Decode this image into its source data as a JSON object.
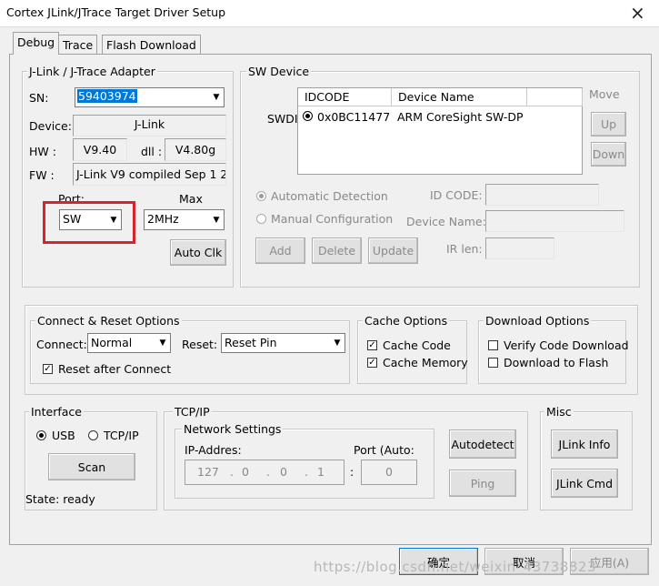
{
  "window": {
    "title": "Cortex JLink/JTrace Target Driver Setup",
    "close_glyph": "×"
  },
  "tabs": [
    {
      "label": "Debug"
    },
    {
      "label": "Trace"
    },
    {
      "label": "Flash Download"
    }
  ],
  "adapter": {
    "group_title": "J-Link / J-Trace Adapter",
    "sn_label": "SN:",
    "sn_value": "59403974",
    "device_label": "Device:",
    "device_value": "J-Link",
    "hw_label": "HW :",
    "hw_value": "V9.40",
    "dll_label": "dll :",
    "dll_value": "V4.80g",
    "fw_label": "FW :",
    "fw_value": "J-Link V9 compiled Sep  1 2",
    "port_label": "Port:",
    "port_value": "SW",
    "max_label": "Max",
    "max_value": "2MHz",
    "auto_clk": "Auto Clk"
  },
  "sw_device": {
    "group_title": "SW Device",
    "swdi_label": "SWDI",
    "columns": [
      "IDCODE",
      "Device Name"
    ],
    "rows": [
      {
        "idcode": "0x0BC11477",
        "name": "ARM CoreSight SW-DP"
      }
    ],
    "move_label": "Move",
    "up": "Up",
    "down": "Down",
    "auto_detection": "Automatic Detection",
    "manual_config": "Manual Configuration",
    "id_code_label": "ID CODE:",
    "device_name_label": "Device Name:",
    "ir_len_label": "IR len:",
    "add": "Add",
    "delete": "Delete",
    "update": "Update"
  },
  "connect_reset": {
    "group_title": "Connect & Reset Options",
    "connect_label": "Connect:",
    "connect_value": "Normal",
    "reset_label": "Reset:",
    "reset_value": "Reset Pin",
    "reset_after_connect": "Reset after Connect"
  },
  "cache": {
    "group_title": "Cache Options",
    "cache_code": "Cache Code",
    "cache_memory": "Cache Memory"
  },
  "download": {
    "group_title": "Download Options",
    "verify": "Verify Code Download",
    "download_flash": "Download to Flash"
  },
  "interface": {
    "group_title": "Interface",
    "usb": "USB",
    "tcpip": "TCP/IP",
    "scan": "Scan",
    "state": "State: ready"
  },
  "tcpip": {
    "group_title": "TCP/IP",
    "network_title": "Network Settings",
    "ip_label": "IP-Addres:",
    "port_label": "Port (Auto:",
    "ip": [
      "127",
      ".",
      "0",
      ".",
      "0",
      ".",
      "1"
    ],
    "colon": ":",
    "port_value": "0",
    "autodetect": "Autodetect",
    "ping": "Ping"
  },
  "misc": {
    "group_title": "Misc",
    "jlink_info": "JLink Info",
    "jlink_cmd": "JLink Cmd"
  },
  "footer": {
    "ok": "确定",
    "cancel": "取消",
    "apply": "应用(A)"
  },
  "watermark": "https://blog.csdn.net/weixin_43738823",
  "colors": {
    "highlight": "#0078d7",
    "red_box": "#d9232b",
    "disabled_text": "#888888"
  }
}
